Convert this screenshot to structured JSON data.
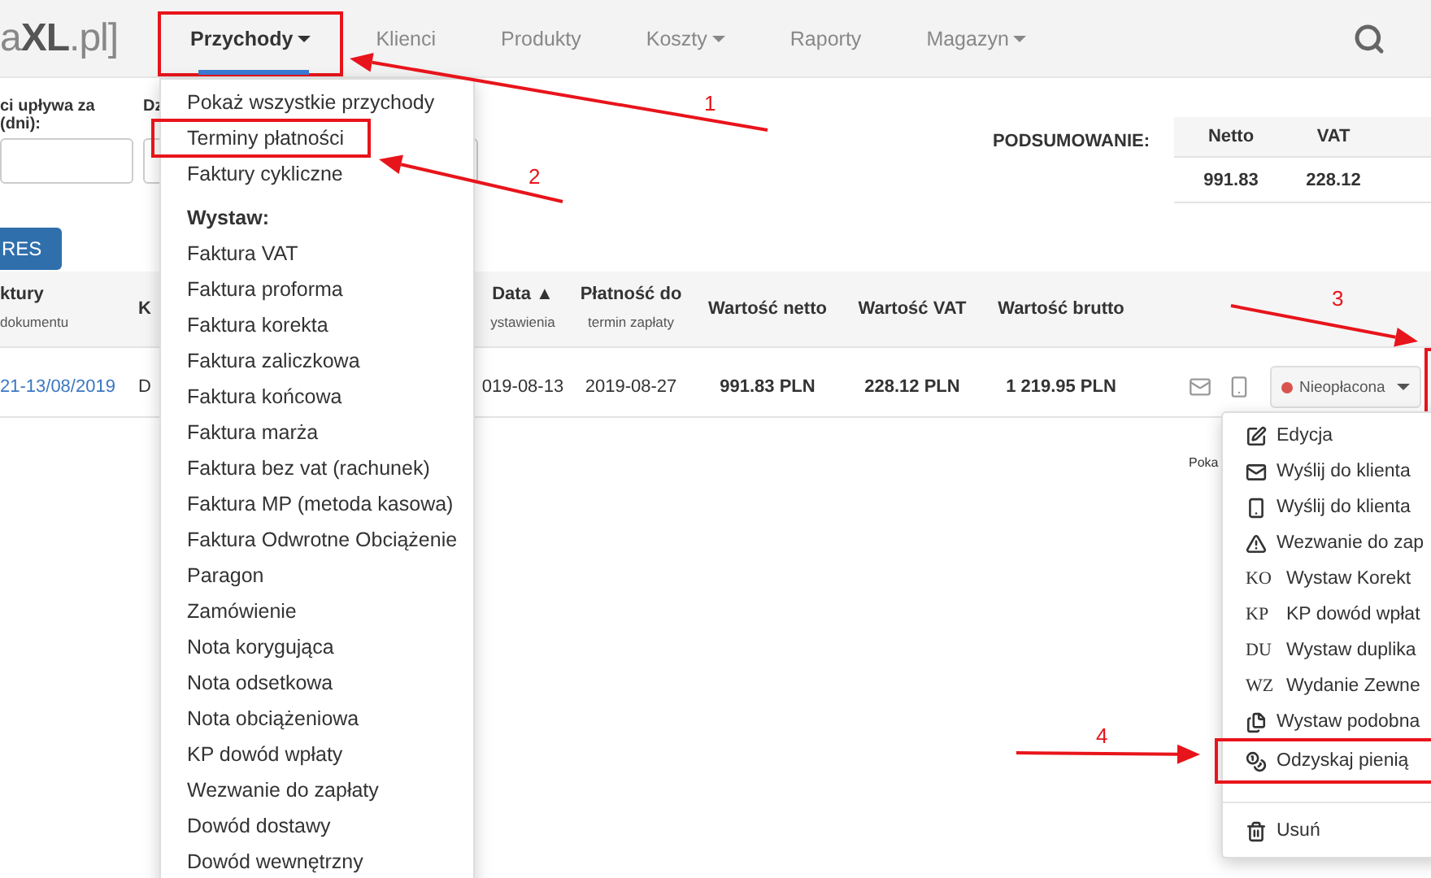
{
  "logo": "a**XL**.pl]",
  "nav": {
    "items": [
      {
        "label": "Przychody",
        "dropdown": true,
        "selected": true,
        "annotated": true
      },
      {
        "label": "Klienci",
        "dropdown": false,
        "selected": false,
        "annotated": false
      },
      {
        "label": "Produkty",
        "dropdown": false,
        "selected": false,
        "annotated": false
      },
      {
        "label": "Koszty",
        "dropdown": true,
        "selected": false,
        "annotated": false
      },
      {
        "label": "Raporty",
        "dropdown": false,
        "selected": false,
        "annotated": false
      },
      {
        "label": "Magazyn",
        "dropdown": true,
        "selected": false,
        "annotated": false
      }
    ]
  },
  "filter": {
    "label": "ci upływa za (dni):",
    "label_2": "Dz",
    "button": "RES"
  },
  "summary": {
    "title": "PODSUMOWANIE:",
    "columns": [
      "Netto",
      "VAT"
    ],
    "values": [
      "991.83",
      "228.12"
    ]
  },
  "table": {
    "columns": [
      {
        "title": "ktury",
        "subtitle": "dokumentu"
      },
      {
        "title": "K"
      },
      {
        "title": "Data ▲",
        "subtitle": "ystawienia"
      },
      {
        "title": "Płatność do",
        "subtitle": "termin zapłaty"
      },
      {
        "title": "Wartość netto"
      },
      {
        "title": "Wartość VAT"
      },
      {
        "title": "Wartość brutto"
      }
    ],
    "rows": [
      {
        "cells": [
          "21-13/08/2019",
          "D",
          "019-08-13",
          "2019-08-27",
          "991.83 PLN",
          "228.12 PLN",
          "1 219.95 PLN"
        ],
        "status": {
          "label": "Nieopłacona",
          "color": "#d9534f"
        },
        "actions_annotated": true
      }
    ]
  },
  "pagination_text": "Poka",
  "income_menu": {
    "items": [
      {
        "kind": "item",
        "label": "Pokaż wszystkie przychody",
        "annotated": false
      },
      {
        "kind": "item",
        "label": "Terminy płatności",
        "annotated": true
      },
      {
        "kind": "item",
        "label": "Faktury cykliczne",
        "annotated": false
      },
      {
        "kind": "header",
        "label": "Wystaw:"
      },
      {
        "kind": "item",
        "label": "Faktura VAT",
        "annotated": false
      },
      {
        "kind": "item",
        "label": "Faktura proforma",
        "annotated": false
      },
      {
        "kind": "item",
        "label": "Faktura korekta",
        "annotated": false
      },
      {
        "kind": "item",
        "label": "Faktura zaliczkowa",
        "annotated": false
      },
      {
        "kind": "item",
        "label": "Faktura końcowa",
        "annotated": false
      },
      {
        "kind": "item",
        "label": "Faktura marża",
        "annotated": false
      },
      {
        "kind": "item",
        "label": "Faktura bez vat (rachunek)",
        "annotated": false
      },
      {
        "kind": "item",
        "label": "Faktura MP (metoda kasowa)",
        "annotated": false
      },
      {
        "kind": "item",
        "label": "Faktura Odwrotne Obciążenie",
        "annotated": false
      },
      {
        "kind": "item",
        "label": "Paragon",
        "annotated": false
      },
      {
        "kind": "item",
        "label": "Zamówienie",
        "annotated": false
      },
      {
        "kind": "item",
        "label": "Nota korygująca",
        "annotated": false
      },
      {
        "kind": "item",
        "label": "Nota odsetkowa",
        "annotated": false
      },
      {
        "kind": "item",
        "label": "Nota obciążeniowa",
        "annotated": false
      },
      {
        "kind": "item",
        "label": "KP dowód wpłaty",
        "annotated": false
      },
      {
        "kind": "item",
        "label": "Wezwanie do zapłaty",
        "annotated": false
      },
      {
        "kind": "item",
        "label": "Dowód dostawy",
        "annotated": false
      },
      {
        "kind": "item",
        "label": "Dowód wewnętrzny",
        "annotated": false
      }
    ]
  },
  "action_menu": {
    "items": [
      {
        "kind": "edit",
        "label": "Edycja",
        "annotated": false
      },
      {
        "kind": "mail",
        "label": "Wyślij do klienta",
        "annotated": false
      },
      {
        "kind": "phone",
        "label": "Wyślij do klienta",
        "annotated": false
      },
      {
        "kind": "warning",
        "label": "Wezwanie do zap",
        "annotated": false
      },
      {
        "kind": "code",
        "code": "KO",
        "label": "Wystaw Korekt",
        "annotated": false
      },
      {
        "kind": "code",
        "code": "KP",
        "label": "KP dowód wpłat",
        "annotated": false
      },
      {
        "kind": "code",
        "code": "DU",
        "label": "Wystaw duplika",
        "annotated": false
      },
      {
        "kind": "code",
        "code": "WZ",
        "label": "Wydanie Zewne",
        "annotated": false
      },
      {
        "kind": "copy",
        "label": "Wystaw podobna",
        "annotated": false
      },
      {
        "kind": "money",
        "label": "Odzyskaj pienią",
        "annotated": true
      },
      {
        "kind": "divider"
      },
      {
        "kind": "trash",
        "label": "Usuń",
        "annotated": false
      }
    ]
  },
  "annotations": [
    {
      "number": "1"
    },
    {
      "number": "2"
    },
    {
      "number": "3"
    },
    {
      "number": "4"
    }
  ]
}
